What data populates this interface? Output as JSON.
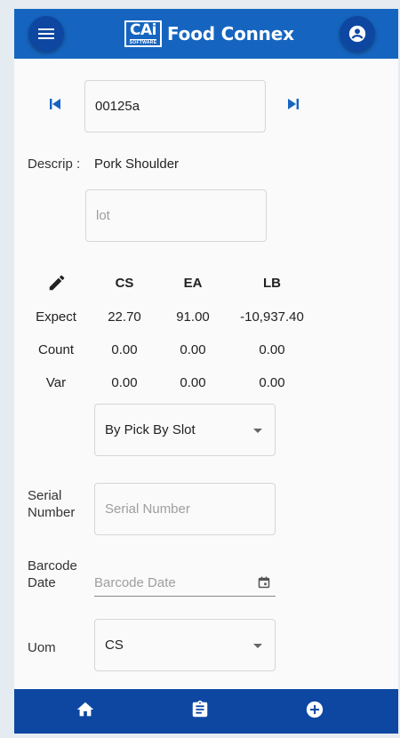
{
  "header": {
    "logo_main": "CAi",
    "logo_sub": "SOFTWARE",
    "app_title": "Food Connex",
    "menu_icon": "menu-icon",
    "account_icon": "account-circle-icon"
  },
  "record": {
    "first_icon": "skip-previous-icon",
    "last_icon": "skip-next-icon",
    "item_value": "00125a"
  },
  "descrip": {
    "label": "Descrip :",
    "value": "Pork Shoulder"
  },
  "lot": {
    "placeholder": "lot"
  },
  "quantities": {
    "edit_icon": "pencil-icon",
    "columns": [
      "CS",
      "EA",
      "LB"
    ],
    "rows": [
      {
        "label": "Expect",
        "values": [
          "22.70",
          "91.00",
          "-10,937.40"
        ]
      },
      {
        "label": "Count",
        "values": [
          "0.00",
          "0.00",
          "0.00"
        ]
      },
      {
        "label": "Var",
        "values": [
          "0.00",
          "0.00",
          "0.00"
        ]
      }
    ]
  },
  "pick_mode": {
    "selected": "By Pick By Slot"
  },
  "serial": {
    "label_line1": "Serial",
    "label_line2": "Number",
    "placeholder": "Serial Number"
  },
  "barcode_date": {
    "label_line1": "Barcode",
    "label_line2": "Date",
    "placeholder": "Barcode Date",
    "icon": "calendar-icon"
  },
  "uom": {
    "label": "Uom",
    "selected": "CS"
  },
  "bottom_nav": {
    "items": [
      {
        "icon": "home-icon"
      },
      {
        "icon": "clipboard-icon"
      },
      {
        "icon": "add-circle-icon"
      }
    ]
  },
  "colors": {
    "header_blue": "#1565c0",
    "bottom_blue": "#0d47a1",
    "nav_icon_blue": "#1565c0"
  }
}
